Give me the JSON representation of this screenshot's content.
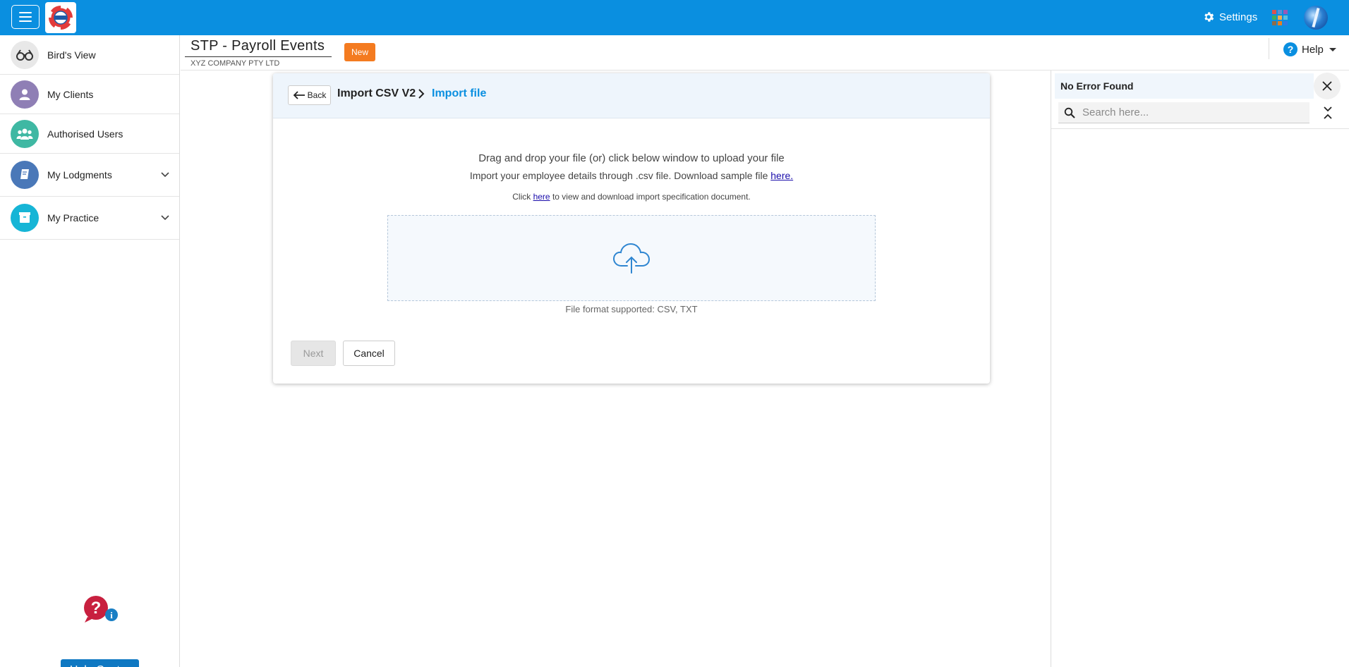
{
  "topbar": {
    "settings_label": "Settings",
    "brand_color": "#0a8fe0"
  },
  "sidebar": {
    "items": [
      {
        "label": "Bird's View",
        "icon": "binoculars-icon"
      },
      {
        "label": "My Clients",
        "icon": "user-icon"
      },
      {
        "label": "Authorised Users",
        "icon": "group-icon"
      },
      {
        "label": "My Lodgments",
        "icon": "document-icon"
      },
      {
        "label": "My Practice",
        "icon": "box-icon"
      }
    ],
    "help_center_label": "Help Center"
  },
  "header": {
    "title": "STP - Payroll Events",
    "subtitle": "XYZ COMPANY PTY LTD",
    "badge": "New",
    "help_label": "Help"
  },
  "card": {
    "back_label": "Back",
    "breadcrumb_root": "Import CSV V2",
    "breadcrumb_current": "Import file",
    "intro_line1": "Drag and drop your file (or) click below window to upload your file",
    "intro_line2_text": "Import your employee details through .csv file. Download sample file ",
    "intro_line2_link": "here.",
    "intro_line3_prefix": "Click ",
    "intro_line3_link": "here",
    "intro_line3_suffix": " to view and download import specification document.",
    "formats_label": "File format supported: CSV, TXT",
    "next_label": "Next",
    "cancel_label": "Cancel"
  },
  "right_panel": {
    "status": "No Error Found",
    "search_placeholder": "Search here..."
  }
}
